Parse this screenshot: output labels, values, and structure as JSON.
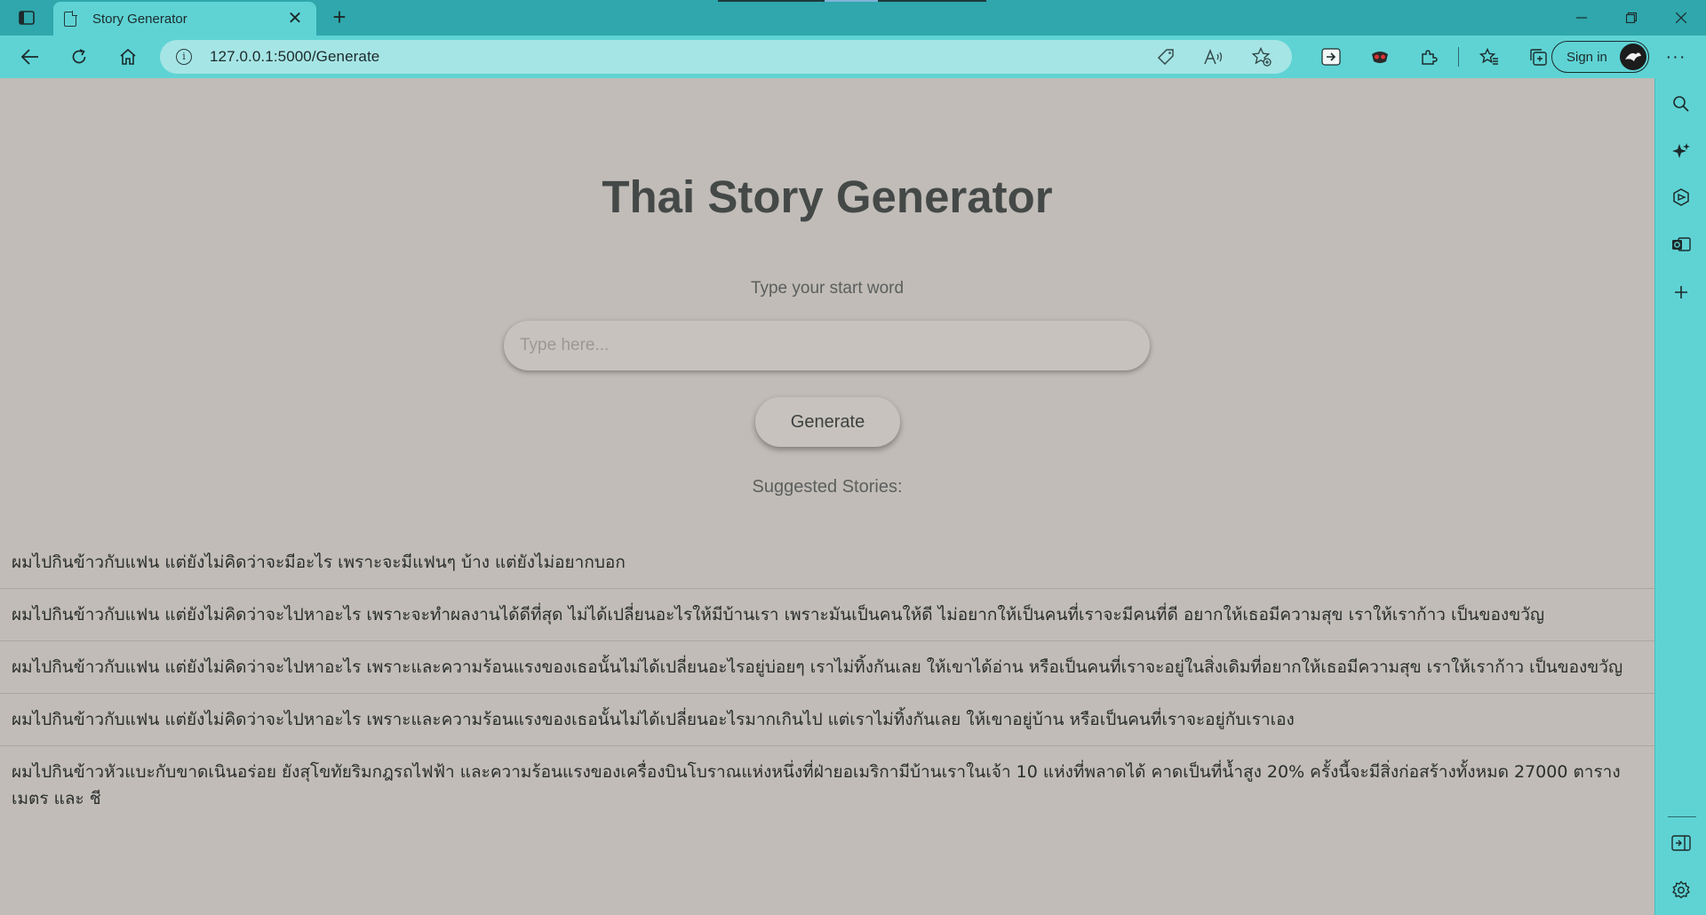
{
  "browser": {
    "tab_title": "Story Generator",
    "new_tab_symbol": "+",
    "close_symbol": "✕",
    "url_host": "127.0.0.1",
    "url_rest": ":5000/Generate",
    "signin_label": "Sign in",
    "more_symbol": "···"
  },
  "page": {
    "title": "Thai Story Generator",
    "prompt_label": "Type your start word",
    "input_placeholder": "Type here...",
    "generate_label": "Generate",
    "suggested_label": "Suggested Stories:"
  },
  "stories": [
    "ผมไปกินข้าวกับแฟน แต่ยังไม่คิดว่าจะมีอะไร เพราะจะมีแฟนๆ บ้าง แต่ยังไม่อยากบอก",
    "ผมไปกินข้าวกับแฟน แต่ยังไม่คิดว่าจะไปหาอะไร เพราะจะทำผลงานได้ดีที่สุด ไม่ได้เปลี่ยนอะไรให้มีบ้านเรา เพราะมันเป็นคนให้ดี ไม่อยากให้เป็นคนที่เราจะมีคนที่ดี อยากให้เธอมีความสุข เราให้เราก้าว เป็นของขวัญ",
    "ผมไปกินข้าวกับแฟน แต่ยังไม่คิดว่าจะไปหาอะไร เพราะและความร้อนแรงของเธอนั้นไม่ได้เปลี่ยนอะไรอยู่บ่อยๆ เราไม่ทิ้งกันเลย ให้เขาได้อ่าน หรือเป็นคนที่เราจะอยู่ในสิ่งเดิมที่อยากให้เธอมีความสุข เราให้เราก้าว เป็นของขวัญ",
    "ผมไปกินข้าวกับแฟน แต่ยังไม่คิดว่าจะไปหาอะไร เพราะและความร้อนแรงของเธอนั้นไม่ได้เปลี่ยนอะไรมากเกินไป แต่เราไม่ทิ้งกันเลย ให้เขาอยู่บ้าน หรือเป็นคนที่เราจะอยู่กับเราเอง",
    "ผมไปกินข้าวหัวแบะกับขาดเนินอร่อย ยังสุโขทัยริมกฎรถไฟฟ้า และความร้อนแรงของเครื่องบินโบราณแห่งหนึ่งที่ฝ่ายอเมริกามีบ้านเราในเจ้า 10 แห่งที่พลาดได้ คาดเป็นที่น้ำสูง 20% ครั้งนี้จะมีสิ่งก่อสร้างทั้งหมด 27000 ตารางเมตร และ ชี"
  ],
  "colors": {
    "browser_frame": "#2fa7ac",
    "toolbar": "#5fd3d4",
    "page_background": "#c1bcb7",
    "title_text": "#444948"
  }
}
